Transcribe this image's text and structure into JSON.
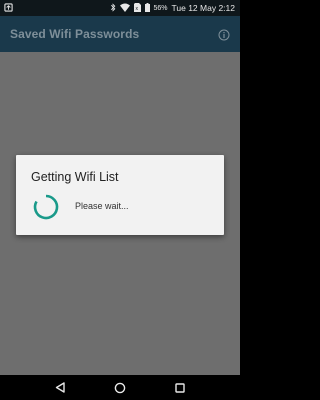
{
  "status_bar": {
    "battery_percent": "56%",
    "clock": "Tue 12 May 2:12",
    "icons": [
      "notification-icon",
      "bluetooth-icon",
      "wifi-icon",
      "sim-icon",
      "battery-icon"
    ]
  },
  "app_bar": {
    "title": "Saved Wifi Passwords",
    "info_icon": "info-icon"
  },
  "dialog": {
    "title": "Getting Wifi List",
    "message": "Please wait...",
    "spinner_color": "#1a9a8a"
  },
  "nav_bar": {
    "buttons": [
      "back-icon",
      "home-icon",
      "recents-icon"
    ]
  },
  "colors": {
    "app_bar": "#1a394b",
    "scrim": "#6e6e6e",
    "dialog": "#f2f2f2",
    "accent": "#1a9a8a"
  }
}
